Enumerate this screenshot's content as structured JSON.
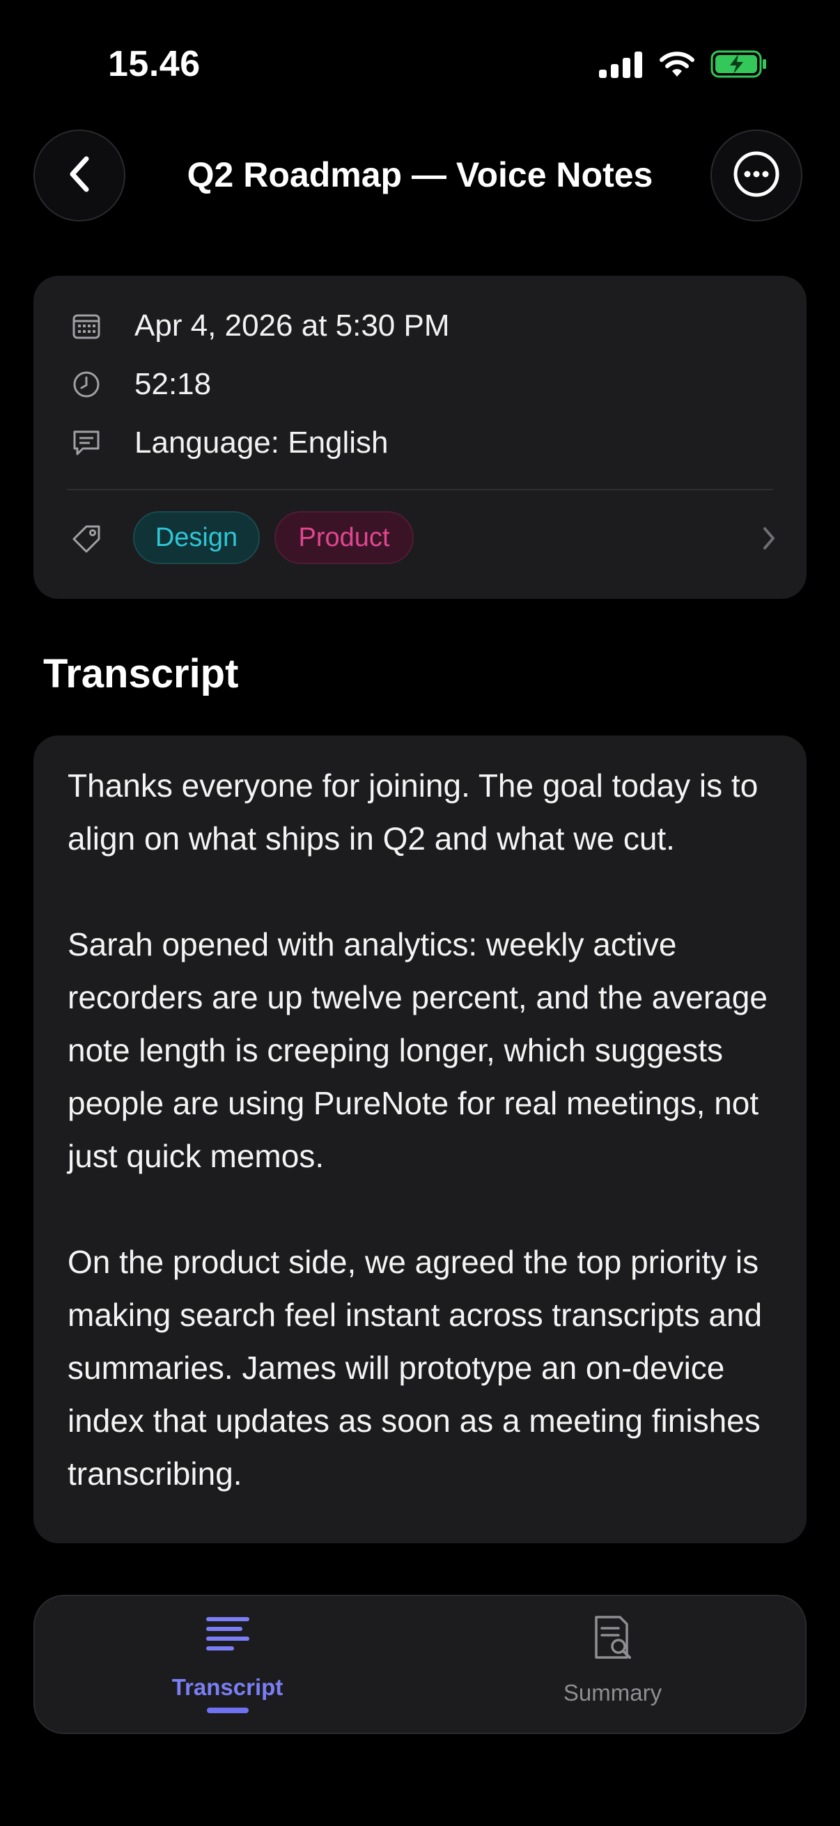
{
  "status_bar": {
    "time": "15.46"
  },
  "header": {
    "title": "Q2 Roadmap — Voice Notes"
  },
  "meta": {
    "date": "Apr 4, 2026 at 5:30 PM",
    "duration": "52:18",
    "language": "Language: English",
    "tags": [
      {
        "label": "Design",
        "color": "#2fc6d6"
      },
      {
        "label": "Product",
        "color": "#e0468f"
      }
    ]
  },
  "transcript": {
    "heading": "Transcript",
    "paragraphs": [
      "Thanks everyone for joining. The goal today is to align on what ships in Q2 and what we cut.",
      "Sarah opened with analytics: weekly active recorders are up twelve percent, and the average note length is creeping longer, which suggests people are using PureNote for real meetings, not just quick memos.",
      "On the product side, we agreed the top priority is making search feel instant across transcripts and summaries. James will prototype an on-device index that updates as soon as a meeting finishes transcribing."
    ]
  },
  "tabs": {
    "active": "Transcript",
    "items": [
      {
        "label": "Transcript",
        "icon": "transcript-lines-icon"
      },
      {
        "label": "Summary",
        "icon": "document-search-icon"
      }
    ]
  },
  "colors": {
    "accent": "#6f72f0",
    "card": "#1c1c1e",
    "background": "#000000"
  }
}
